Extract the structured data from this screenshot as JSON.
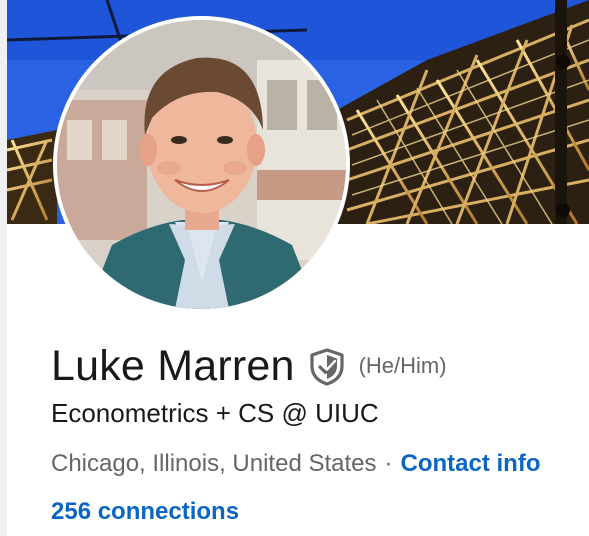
{
  "profile": {
    "name": "Luke Marren",
    "pronouns": "(He/Him)",
    "headline": "Econometrics + CS @ UIUC",
    "location": "Chicago, Illinois, United States",
    "separator": "·",
    "contact_label": "Contact info",
    "connections_label": "256 connections"
  },
  "icons": {
    "verified": "shield-check-icon"
  },
  "colors": {
    "link": "#0a66c2",
    "primary_text": "#191919",
    "secondary_text": "#666666",
    "banner_sky": "#2563e8",
    "banner_structure": "#e7c36a"
  }
}
